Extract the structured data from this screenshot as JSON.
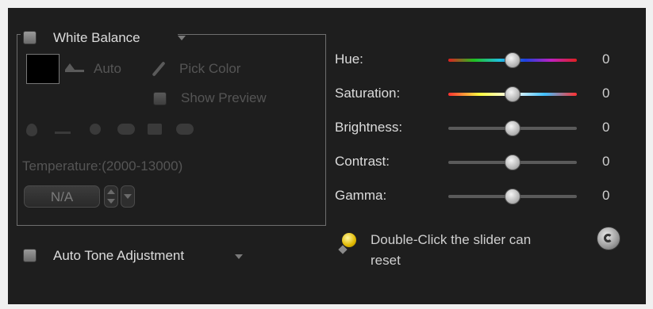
{
  "white_balance": {
    "title": "White Balance",
    "auto_label": "Auto",
    "pick_color_label": "Pick Color",
    "show_preview_label": "Show Preview",
    "temperature_label": "Temperature:(2000-13000)",
    "temperature_value": "N/A",
    "presets": [
      "drop-icon",
      "tungsten-icon",
      "sun-icon",
      "cloud-icon",
      "house-icon",
      "shade-icon"
    ]
  },
  "auto_tone": {
    "label": "Auto Tone Adjustment"
  },
  "sliders": [
    {
      "label": "Hue:",
      "value": "0",
      "position": 0.5
    },
    {
      "label": "Saturation:",
      "value": "0",
      "position": 0.5
    },
    {
      "label": "Brightness:",
      "value": "0",
      "position": 0.5
    },
    {
      "label": "Contrast:",
      "value": "0",
      "position": 0.5
    },
    {
      "label": "Gamma:",
      "value": "0",
      "position": 0.5
    }
  ],
  "hint": {
    "text_line1": "Double-Click the slider can",
    "text_line2": "reset"
  },
  "colors": {
    "background": "#1e1e1e",
    "text": "#dcdcdc",
    "disabled_text": "#555555",
    "hue_gradient": [
      "#e02020",
      "#20c020",
      "#20c0e0",
      "#2040e0",
      "#c020c0",
      "#e02020"
    ],
    "saturation_gradient": [
      "#ff3030",
      "#ffff40",
      "#ffffff",
      "#40c0ff",
      "#ff3030"
    ]
  }
}
